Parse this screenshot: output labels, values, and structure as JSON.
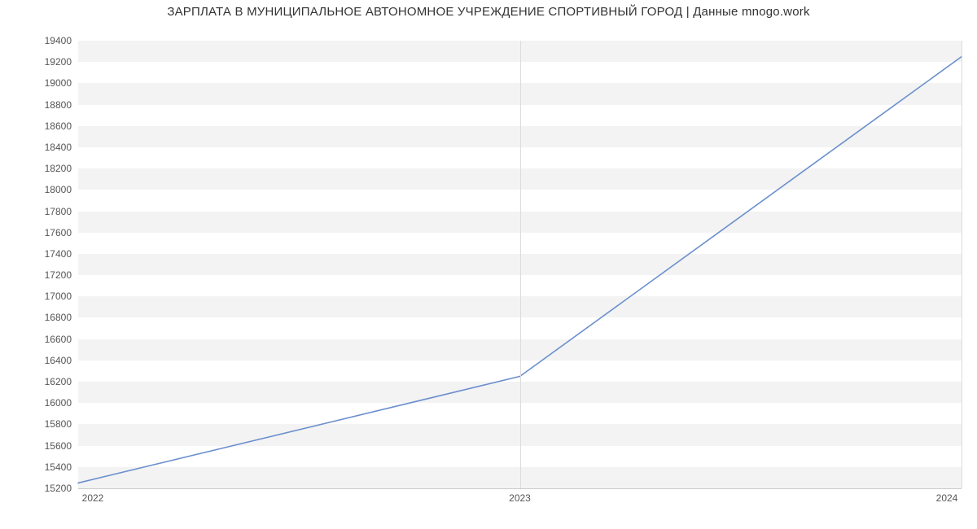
{
  "chart_data": {
    "type": "line",
    "title": "ЗАРПЛАТА В МУНИЦИПАЛЬНОЕ АВТОНОМНОЕ УЧРЕЖДЕНИЕ СПОРТИВНЫЙ ГОРОД | Данные mnogo.work",
    "xlabel": "",
    "ylabel": "",
    "x": [
      2022,
      2023,
      2024
    ],
    "values": [
      15250,
      16250,
      19250
    ],
    "x_ticks": [
      2022,
      2023,
      2024
    ],
    "y_ticks": [
      15200,
      15400,
      15600,
      15800,
      16000,
      16200,
      16400,
      16600,
      16800,
      17000,
      17200,
      17400,
      17600,
      17800,
      18000,
      18200,
      18400,
      18600,
      18800,
      19000,
      19200,
      19400
    ],
    "xlim": [
      2022,
      2024
    ],
    "ylim": [
      15200,
      19400
    ],
    "line_color": "#6b8fce",
    "band_color": "#f3f3f3"
  }
}
